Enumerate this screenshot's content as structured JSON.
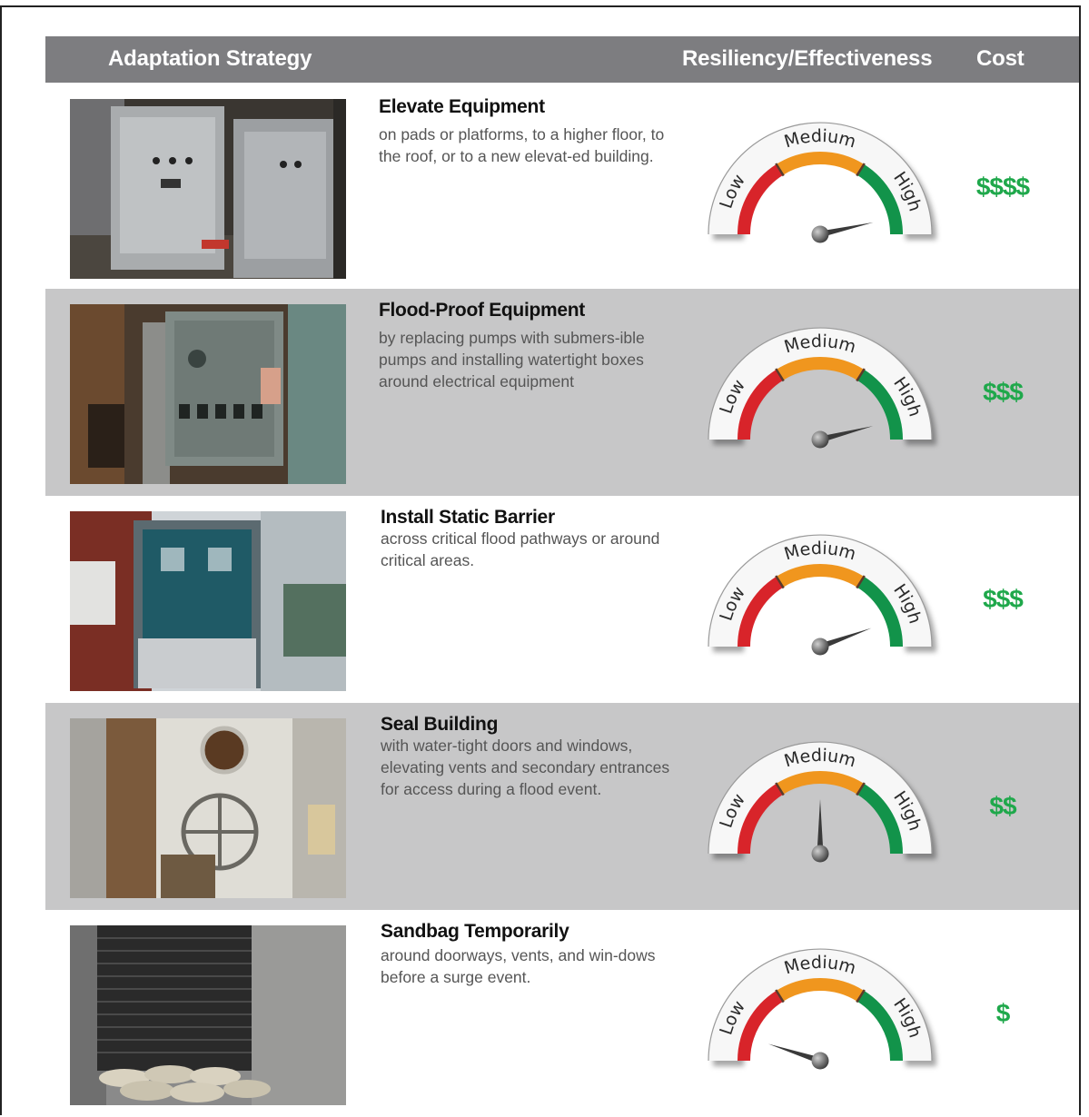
{
  "header": {
    "strategy": "Adaptation Strategy",
    "resiliency": "Resiliency/Effectiveness",
    "cost": "Cost"
  },
  "gauge_labels": {
    "low": "Low",
    "medium": "Medium",
    "high": "High"
  },
  "colors": {
    "low": "#d8242a",
    "medium": "#f0961e",
    "high": "#12934a",
    "cost": "#1fa84b",
    "header": "#7d7d80"
  },
  "strategies": [
    {
      "title": "Elevate Equipment",
      "desc": "on pads or platforms, to a higher floor, to the roof, or to a new elevat-ed building.",
      "cost": "$$$$",
      "effectiveness": 0.93,
      "photo": "electrical-panels"
    },
    {
      "title": "Flood-Proof Equipment",
      "desc": "by replacing pumps with submers-ible pumps and installing watertight boxes around electrical equipment",
      "cost": "$$$",
      "effectiveness": 0.92,
      "photo": "watertight-box"
    },
    {
      "title": "Install Static Barrier",
      "desc": "across critical flood pathways or around critical areas.",
      "cost": "$$$",
      "effectiveness": 0.89,
      "photo": "door-barrier"
    },
    {
      "title": "Seal Building",
      "desc": "with water-tight doors and windows, elevating vents and secondary entrances for access during a flood event.",
      "cost": "$$",
      "effectiveness": 0.5,
      "photo": "watertight-door"
    },
    {
      "title": "Sandbag Temporarily",
      "desc": "around doorways, vents, and win-dows before a surge event.",
      "cost": "$",
      "effectiveness": 0.1,
      "photo": "sandbags-vent"
    }
  ]
}
